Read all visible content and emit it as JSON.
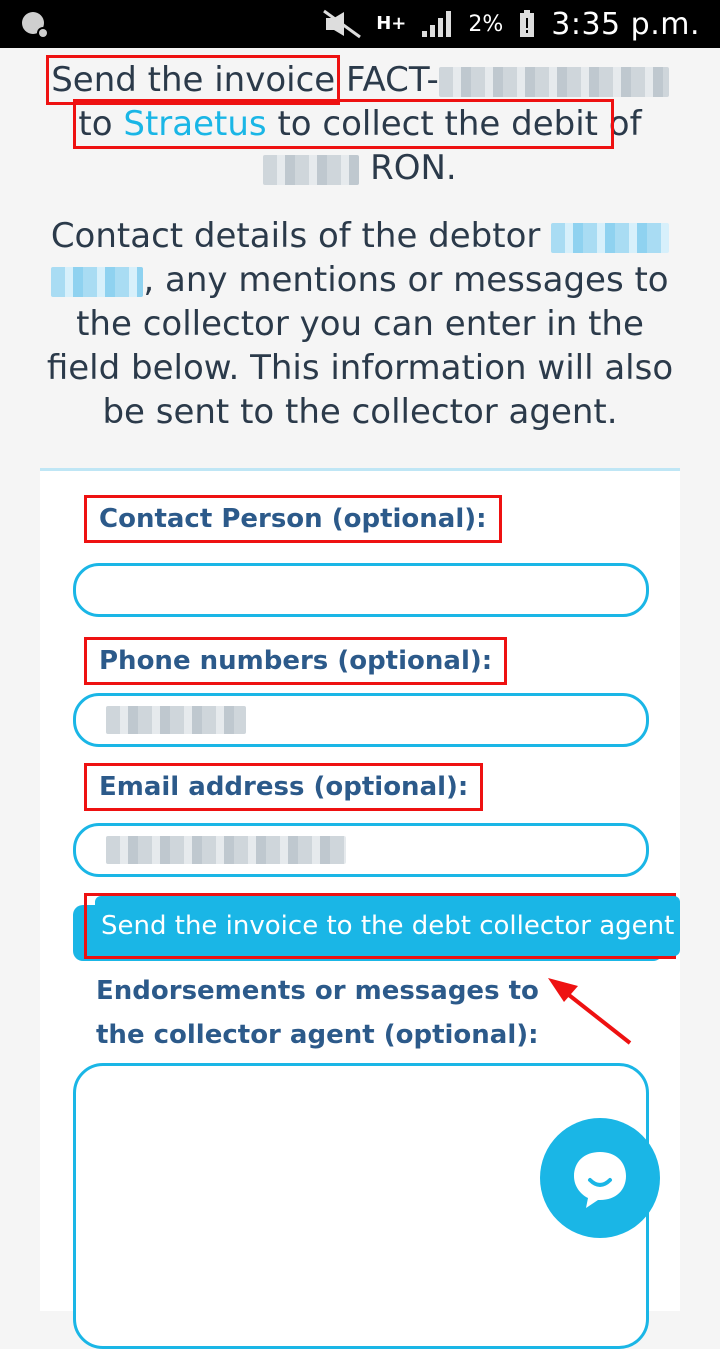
{
  "status_bar": {
    "battery_percent": "2%",
    "network": "H+",
    "time": "3:35 p.m."
  },
  "intro": {
    "line1_prefix": "Send the invoice",
    "line1_suffix": "FACT-",
    "line2_prefix": "to",
    "collector_link": "Straetus",
    "line2_mid": "to collect the debit",
    "line2_suffix": "of",
    "currency_suffix": "RON."
  },
  "contact_paragraph": {
    "prefix": "Contact details of the debtor",
    "suffix": ", any mentions or messages to the collector you can enter in the field below. This information will also be sent to the collector agent."
  },
  "form": {
    "contact_person_label": "Contact Person (optional):",
    "phone_label": "Phone numbers (optional):",
    "email_label": "Email address (optional):",
    "send_button_label": "Send the invoice to the debt collector agent",
    "endorsements_label": "Endorsements or messages to the collector agent (optional):"
  },
  "icons": {
    "chat": "chat-bubble-icon",
    "status_left": "notification-icon"
  },
  "colors": {
    "accent": "#1ab6e6",
    "label": "#2c5a8a",
    "highlight": "#ee1111"
  }
}
